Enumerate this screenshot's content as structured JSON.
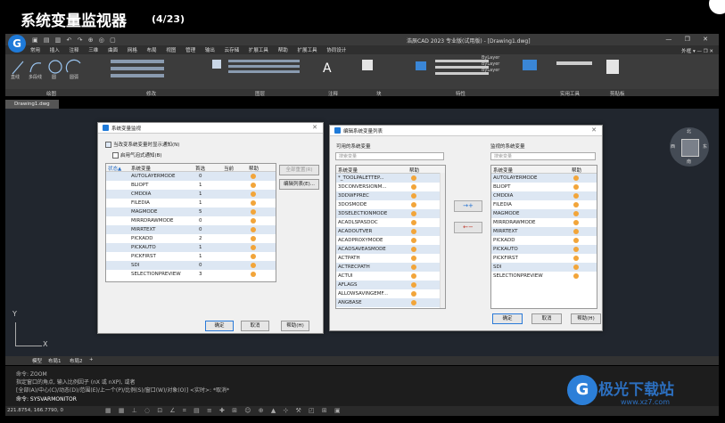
{
  "caption": {
    "title": "系统变量监视器",
    "counter": "(4/23)"
  },
  "app": {
    "logo": "G",
    "quick_access": "▣ ▤ ▥ ↶ ↷ ⊕ ◎ ▢",
    "title": "浩辰CAD 2023 专业版(试用版) - [Drawing1.dwg]",
    "window_controls": "— ❐ ✕",
    "menu": [
      "常用",
      "插入",
      "注释",
      "三维",
      "曲面",
      "网格",
      "布局",
      "视图",
      "管理",
      "输出",
      "云存储",
      "扩展工具",
      "帮助",
      "扩展工具",
      "协同设计"
    ],
    "menu_right": "外框 ▾ — ❐ ✕",
    "ribbon_groups": [
      "绘图",
      "修改",
      "图层",
      "注释",
      "块",
      "特性",
      "实用工具",
      "剪贴板"
    ],
    "ribbon_layer": "ByLayer",
    "file_tab": "Drawing1.dwg",
    "layout_tabs": [
      "模型",
      "布局1",
      "布局2",
      "+"
    ],
    "command_lines": [
      "命令: ZOOM",
      "指定窗口的角点, 输入比例因子 (nX 或 nXP), 或者",
      "[全部(A)/中心(C)/动态(D)/范围(E)/上一个(P)/比例(S)/窗口(W)/对象(O)] <实时>: *取消*",
      "命令: SYSVARMONITOR"
    ],
    "coords": "221.8754, 166.7790, 0",
    "status_icons": "▦ ▦ ⊥ ◌ ⊡ ∠ ⌗ ▤ ≡ ✚ ⊞ ☺ ⊕ ▲ ⊹ ⚒ ◰ ⊞ ▣"
  },
  "dialog1": {
    "title": "系统变量监视",
    "notify_label": "当改变系统变量时显示通知(N)",
    "balloon_label": "启用气泡式通知(B)",
    "columns": [
      "状态▲",
      "系统变量",
      "首选",
      "当前",
      "帮助"
    ],
    "rows": [
      {
        "name": "AUTOLAYERMODE",
        "pref": "0"
      },
      {
        "name": "BLIOPT",
        "pref": "1"
      },
      {
        "name": "CMDDIA",
        "pref": "1"
      },
      {
        "name": "FILEDIA",
        "pref": "1"
      },
      {
        "name": "MAGMODE",
        "pref": "5"
      },
      {
        "name": "MIRRDRAWMODE",
        "pref": "0"
      },
      {
        "name": "MIRRTEXT",
        "pref": "0"
      },
      {
        "name": "PICKADD",
        "pref": "2"
      },
      {
        "name": "PICKAUTO",
        "pref": "1"
      },
      {
        "name": "PICKFIRST",
        "pref": "1"
      },
      {
        "name": "SDI",
        "pref": "0"
      },
      {
        "name": "SELECTIONPREVIEW",
        "pref": "3"
      }
    ],
    "btn_reset": "全部重置(R)",
    "btn_edit": "编辑列表(E)...",
    "ok": "确定",
    "cancel": "取消",
    "help": "帮助(H)"
  },
  "dialog2": {
    "title": "编辑系统变量列表",
    "available_label": "可用的系统变量",
    "monitored_label": "监视的系统变量",
    "search_placeholder": "搜索变量",
    "col_var": "系统变量",
    "col_help": "帮助",
    "available": [
      "*_TOOLPALETTEP...",
      "3DCONVERSIONM...",
      "3DDWFPREC",
      "3DOSMODE",
      "3DSELECTIONMODE",
      "ACADLSPASDOC",
      "ACADOUTVER",
      "ACADPROXYMODE",
      "ACADSAVEASMODE",
      "ACTPATH",
      "ACTRECPATH",
      "ACTUI",
      "AFLAGS",
      "ALLOWSAVINGEMF...",
      "ANGBASE"
    ],
    "monitored": [
      "AUTOLAYERMODE",
      "BLIOPT",
      "CMDDIA",
      "FILEDIA",
      "MAGMODE",
      "MIRRDRAWMODE",
      "MIRRTEXT",
      "PICKADD",
      "PICKAUTO",
      "PICKFIRST",
      "SDI",
      "SELECTIONPREVIEW"
    ],
    "add_btn": "→+",
    "remove_btn": "←−",
    "ok": "确定",
    "cancel": "取消",
    "help": "帮助(H)"
  },
  "viewcube": {
    "north": "北",
    "east": "东",
    "west": "西",
    "south": "南",
    "top": "上"
  },
  "watermark": {
    "text": "极光下载站",
    "url": "www.xz7.com",
    "logo": "G"
  },
  "ucs": {
    "y": "Y",
    "x": "X"
  }
}
